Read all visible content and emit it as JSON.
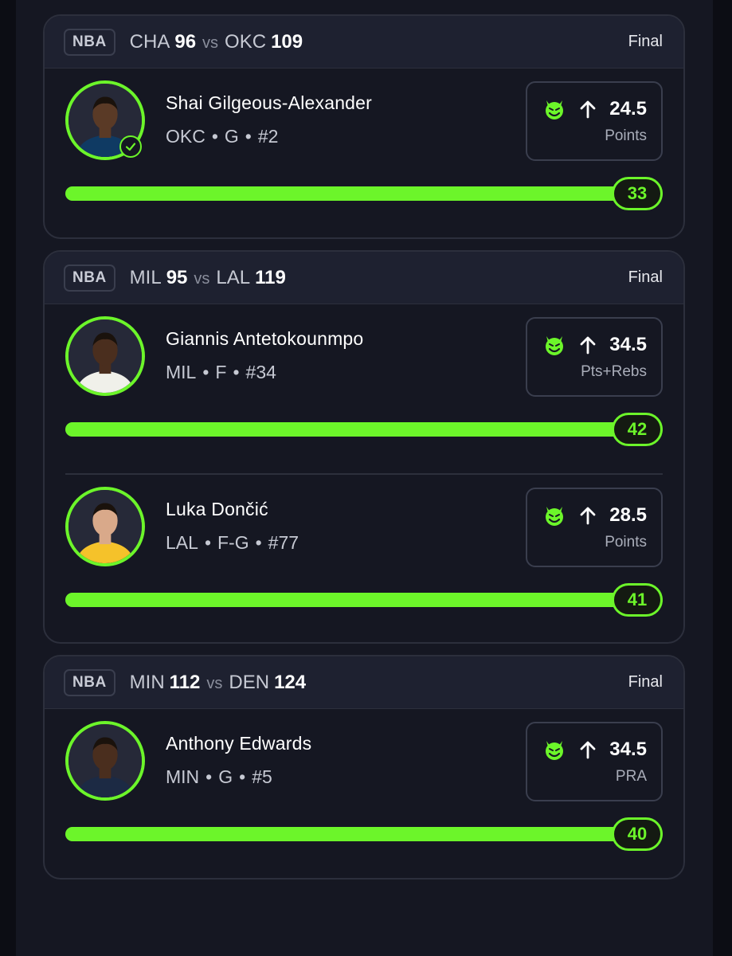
{
  "accent": "#6cf52a",
  "games": [
    {
      "league": "NBA",
      "away_team": "CHA",
      "away_score": "96",
      "vs": "vs",
      "home_team": "OKC",
      "home_score": "109",
      "status": "Final",
      "players": [
        {
          "name": "Shai Gilgeous-Alexander",
          "team": "OKC",
          "position": "G",
          "number": "#2",
          "direction_icon": "arrow-up-icon",
          "line": "24.5",
          "stat": "Points",
          "result": "33",
          "progress": 1.0,
          "jersey_color": "#0f3a63",
          "skin": "#5a3a26"
        }
      ]
    },
    {
      "league": "NBA",
      "away_team": "MIL",
      "away_score": "95",
      "vs": "vs",
      "home_team": "LAL",
      "home_score": "119",
      "status": "Final",
      "players": [
        {
          "name": "Giannis Antetokounmpo",
          "team": "MIL",
          "position": "F",
          "number": "#34",
          "direction_icon": "arrow-up-icon",
          "line": "34.5",
          "stat": "Pts+Rebs",
          "result": "42",
          "progress": 1.0,
          "jersey_color": "#f0f0ea",
          "skin": "#4a2e1e"
        },
        {
          "name": "Luka Dončić",
          "team": "LAL",
          "position": "F-G",
          "number": "#77",
          "direction_icon": "arrow-up-icon",
          "line": "28.5",
          "stat": "Points",
          "result": "41",
          "progress": 1.0,
          "jersey_color": "#f5c22a",
          "skin": "#d9a98a"
        }
      ]
    },
    {
      "league": "NBA",
      "away_team": "MIN",
      "away_score": "112",
      "vs": "vs",
      "home_team": "DEN",
      "home_score": "124",
      "status": "Final",
      "players": [
        {
          "name": "Anthony Edwards",
          "team": "MIN",
          "position": "G",
          "number": "#5",
          "direction_icon": "arrow-up-icon",
          "line": "34.5",
          "stat": "PRA",
          "result": "40",
          "progress": 1.0,
          "jersey_color": "#1c2a44",
          "skin": "#4a2e1e"
        }
      ]
    }
  ]
}
